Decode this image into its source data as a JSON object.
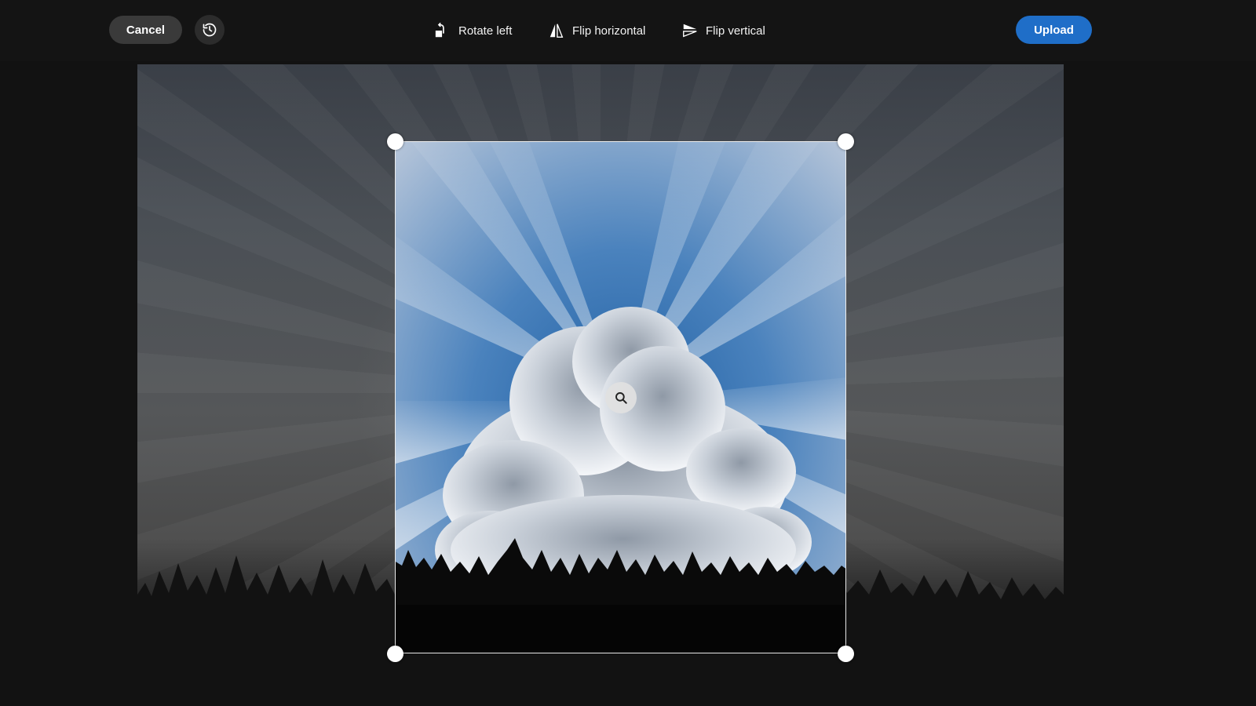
{
  "toolbar": {
    "cancel_label": "Cancel",
    "history_icon": "history-icon",
    "rotate_left_label": "Rotate left",
    "rotate_left_icon": "rotate-left-icon",
    "flip_horizontal_label": "Flip horizontal",
    "flip_horizontal_icon": "flip-horizontal-icon",
    "flip_vertical_label": "Flip vertical",
    "flip_vertical_icon": "flip-vertical-icon",
    "upload_label": "Upload"
  },
  "editor": {
    "zoom_icon": "zoom-icon"
  },
  "colors": {
    "background": "#121212",
    "cancel_button": "#3a3a3a",
    "upload_button": "#1f6ec8",
    "sky_blue": "#2f6fb0"
  }
}
